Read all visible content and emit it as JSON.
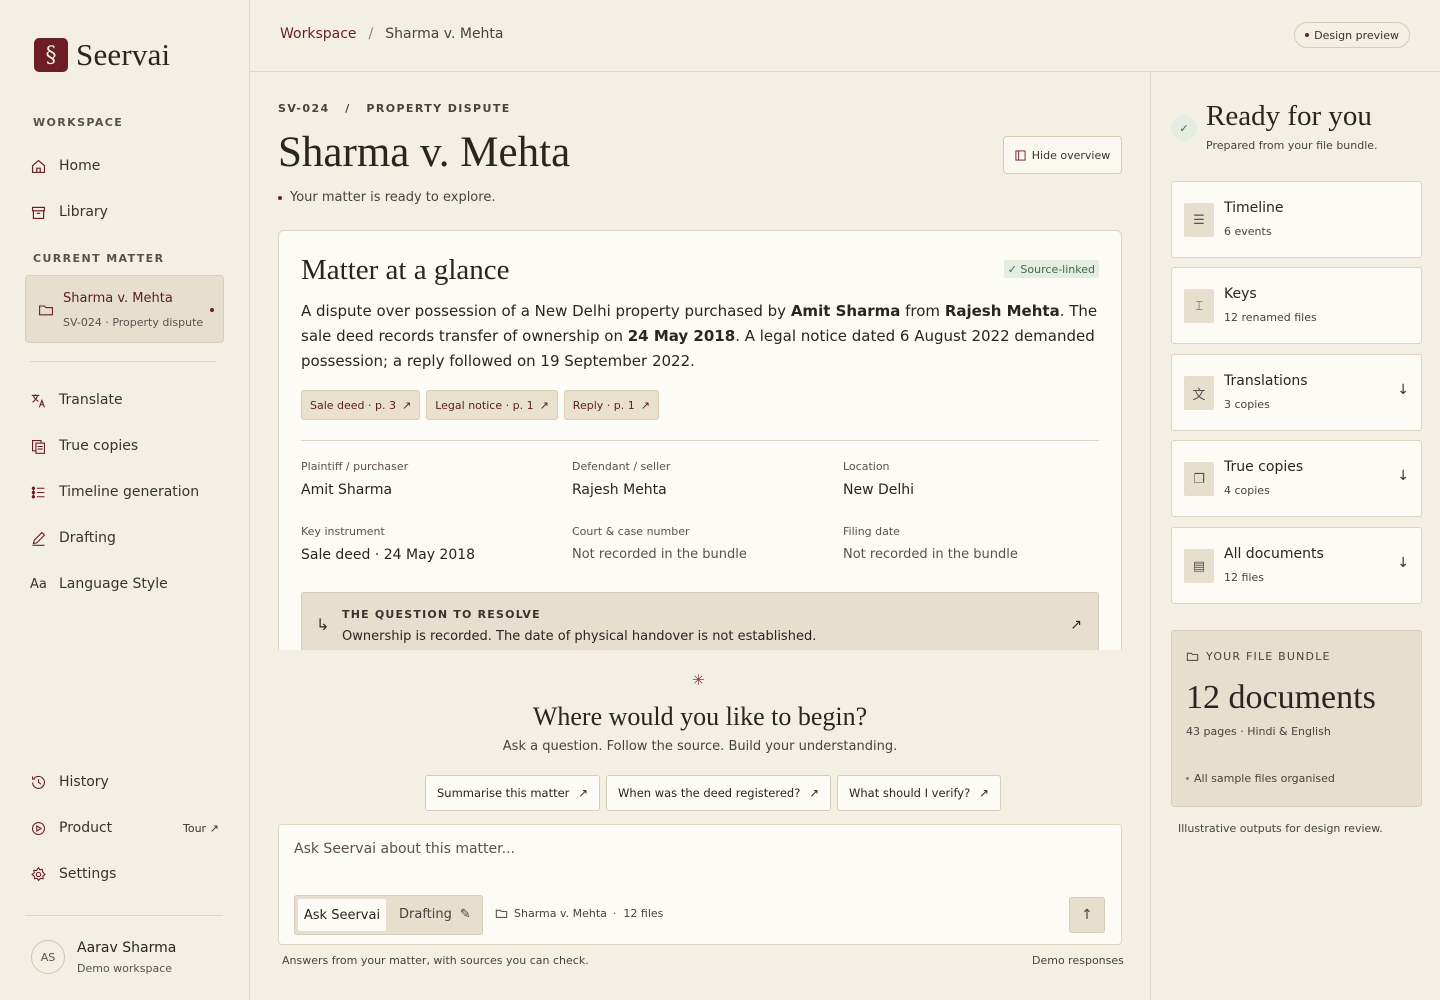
{
  "brand": {
    "mark": "§",
    "name": "Seervai"
  },
  "sidebar": {
    "workspace_label": "WORKSPACE",
    "workspace_items": [
      {
        "label": "Home",
        "icon": "home-icon"
      },
      {
        "label": "Library",
        "icon": "archive-icon"
      }
    ],
    "current_label": "CURRENT MATTER",
    "current_matter": {
      "title": "Sharma v. Mehta",
      "subtitle": "SV-024 · Property dispute"
    },
    "tools": [
      {
        "label": "Translate",
        "icon": "translate-icon"
      },
      {
        "label": "True copies",
        "icon": "copies-icon"
      },
      {
        "label": "Timeline generation",
        "icon": "timeline-icon"
      },
      {
        "label": "Drafting",
        "icon": "pen-icon"
      },
      {
        "label": "Language Style",
        "icon": "font-icon",
        "glyph": "Aa"
      }
    ],
    "bottom": [
      {
        "label": "History",
        "icon": "history-icon"
      },
      {
        "label": "Product",
        "icon": "play-icon"
      },
      {
        "label": "Settings",
        "icon": "gear-icon"
      }
    ],
    "tour_label": "Tour ↗",
    "user": {
      "initials": "AS",
      "name": "Aarav Sharma",
      "workspace": "Demo workspace"
    }
  },
  "topbar": {
    "breadcrumb_root": "Workspace",
    "breadcrumb_sep": "/",
    "breadcrumb_current": "Sharma v. Mehta",
    "preview_pill": "Design preview"
  },
  "matter": {
    "eyebrow": "SV-024   /   PROPERTY DISPUTE",
    "title": "Sharma v. Mehta",
    "status": "Your matter is ready to explore.",
    "hide_overview": "Hide overview"
  },
  "glance": {
    "heading": "Matter at a glance",
    "badge": "✓ Source-linked",
    "summary": {
      "p1": "A dispute over possession of a New Delhi property purchased by ",
      "b1": "Amit Sharma",
      "p2": " from ",
      "b2": "Rajesh Mehta",
      "p3": ". The sale deed records transfer of ownership on ",
      "b3": "24 May 2018",
      "p4": ". A legal notice dated 6 August 2022 demanded possession; a reply followed on 19 September 2022."
    },
    "chips": [
      "Sale deed · p. 3",
      "Legal notice · p. 1",
      "Reply · p. 1"
    ],
    "fields": [
      {
        "label": "Plaintiff / purchaser",
        "value": "Amit Sharma"
      },
      {
        "label": "Defendant / seller",
        "value": "Rajesh Mehta"
      },
      {
        "label": "Location",
        "value": "New Delhi"
      },
      {
        "label": "Key instrument",
        "value": "Sale deed · 24 May 2018"
      },
      {
        "label": "Court & case number",
        "value": "Not recorded in the bundle"
      },
      {
        "label": "Filing date",
        "value": "Not recorded in the bundle"
      }
    ],
    "question_label": "THE QUESTION TO RESOLVE",
    "question_text": "Ownership is recorded. The date of physical handover is not established."
  },
  "begin": {
    "heading": "Where would you like to begin?",
    "sub": "Ask a question. Follow the source. Build your understanding.",
    "prompts": [
      "Summarise this matter",
      "When was the deed registered?",
      "What should I verify?"
    ]
  },
  "composer": {
    "placeholder": "Ask Seervai about this matter...",
    "mode_on": "Ask Seervai",
    "mode_off": "Drafting",
    "scope_name": "Sharma v. Mehta",
    "scope_count": "·  12 files",
    "footer_left": "Answers from your matter, with sources you can check.",
    "footer_right": "Demo responses"
  },
  "ready": {
    "title": "Ready for you",
    "subtitle": "Prepared from your file bundle.",
    "cards": [
      {
        "title": "Timeline",
        "sub": "6 events",
        "icon": "timeline-icon",
        "download": false
      },
      {
        "title": "Keys",
        "sub": "12 renamed files",
        "icon": "keys-icon",
        "download": false
      },
      {
        "title": "Translations",
        "sub": "3 copies",
        "icon": "translate-icon",
        "download": true
      },
      {
        "title": "True copies",
        "sub": "4 copies",
        "icon": "copies-icon",
        "download": true
      },
      {
        "title": "All documents",
        "sub": "12 files",
        "icon": "archive-icon",
        "download": true
      }
    ],
    "bundle": {
      "label": "YOUR FILE BUNDLE",
      "count": "12 documents",
      "pages": "43 pages · Hindi & English",
      "organised": "All sample files organised"
    },
    "note": "Illustrative outputs for design review."
  },
  "colors": {
    "accent": "#6b1e24",
    "background": "#f4efe3",
    "card": "#fdfbf6",
    "muted_card": "#e6dfcd",
    "success": "#3d6b47"
  }
}
